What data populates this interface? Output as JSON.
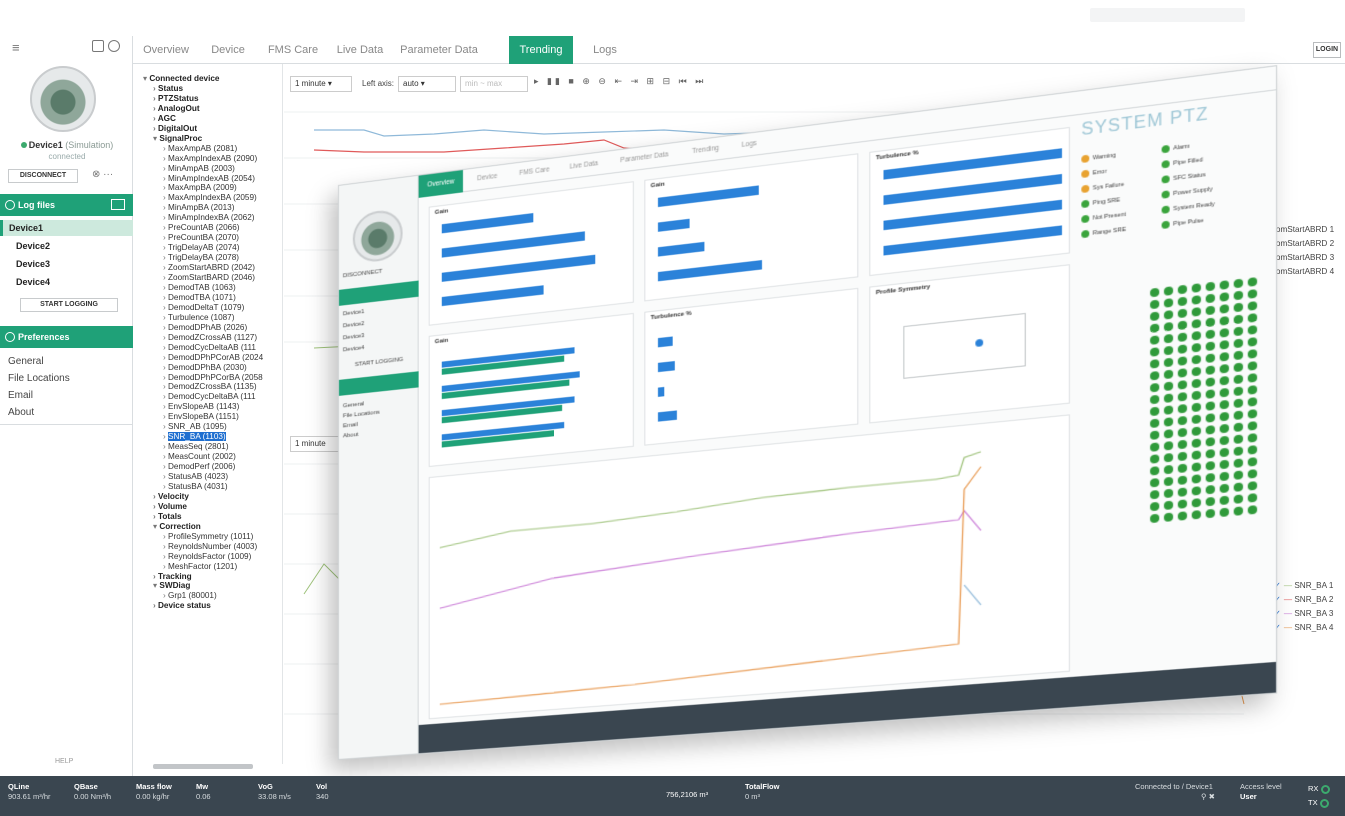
{
  "header": {
    "login_label": "LOGIN"
  },
  "tabs": [
    "Overview",
    "Device",
    "FMS Care",
    "Live Data",
    "Parameter Data",
    "Trending",
    "Logs"
  ],
  "active_tab": "Trending",
  "sidebar": {
    "device_name": "Device1",
    "device_status": "(Simulation)",
    "device_sub": "connected",
    "disconnect_label": "DISCONNECT",
    "log_files_label": "Log files",
    "devices": [
      "Device1",
      "Device2",
      "Device3",
      "Device4"
    ],
    "selected_device": "Device1",
    "start_logging_label": "START LOGGING",
    "preferences_label": "Preferences",
    "preferences_items": [
      "General",
      "File Locations",
      "Email",
      "About"
    ],
    "footer": "HELP"
  },
  "tree": {
    "items": [
      {
        "text": "Connected device",
        "level": 0,
        "bold": true,
        "toggle": "▾"
      },
      {
        "text": "Status",
        "level": 1,
        "bold": true,
        "toggle": "›"
      },
      {
        "text": "PTZStatus",
        "level": 1,
        "bold": true,
        "toggle": "›"
      },
      {
        "text": "AnalogOut",
        "level": 1,
        "bold": true,
        "toggle": "›"
      },
      {
        "text": "AGC",
        "level": 1,
        "bold": true,
        "toggle": "›"
      },
      {
        "text": "DigitalOut",
        "level": 1,
        "bold": true,
        "toggle": "›"
      },
      {
        "text": "SignalProc",
        "level": 1,
        "bold": true,
        "toggle": "▾"
      },
      {
        "text": "MaxAmpAB (2081)",
        "level": 2
      },
      {
        "text": "MaxAmpIndexAB (2090)",
        "level": 2
      },
      {
        "text": "MinAmpAB (2003)",
        "level": 2
      },
      {
        "text": "MinAmpIndexAB (2054)",
        "level": 2
      },
      {
        "text": "MaxAmpBA (2009)",
        "level": 2
      },
      {
        "text": "MaxAmpIndexBA (2059)",
        "level": 2
      },
      {
        "text": "MinAmpBA (2013)",
        "level": 2
      },
      {
        "text": "MinAmpIndexBA (2062)",
        "level": 2
      },
      {
        "text": "PreCountAB (2066)",
        "level": 2
      },
      {
        "text": "PreCountBA (2070)",
        "level": 2
      },
      {
        "text": "TrigDelayAB (2074)",
        "level": 2
      },
      {
        "text": "TrigDelayBA (2078)",
        "level": 2
      },
      {
        "text": "ZoomStartABRD (2042)",
        "level": 2
      },
      {
        "text": "ZoomStartBARD (2046)",
        "level": 2
      },
      {
        "text": "DemodTAB (1063)",
        "level": 2
      },
      {
        "text": "DemodTBA (1071)",
        "level": 2
      },
      {
        "text": "DemodDeltaT (1079)",
        "level": 2
      },
      {
        "text": "Turbulence (1087)",
        "level": 2
      },
      {
        "text": "DemodDPhAB (2026)",
        "level": 2
      },
      {
        "text": "DemodZCrossAB (1127)",
        "level": 2
      },
      {
        "text": "DemodCycDeltaAB (111",
        "level": 2
      },
      {
        "text": "DemodDPhPCorAB (2024",
        "level": 2
      },
      {
        "text": "DemodDPhBA (2030)",
        "level": 2
      },
      {
        "text": "DemodDPhPCorBA (2058",
        "level": 2
      },
      {
        "text": "DemodZCrossBA (1135)",
        "level": 2
      },
      {
        "text": "DemodCycDeltaBA (111",
        "level": 2
      },
      {
        "text": "EnvSlopeAB (1143)",
        "level": 2
      },
      {
        "text": "EnvSlopeBA (1151)",
        "level": 2
      },
      {
        "text": "SNR_AB (1095)",
        "level": 2
      },
      {
        "text": "SNR_BA (1103)",
        "level": 2,
        "highlight": true
      },
      {
        "text": "MeasSeq (2801)",
        "level": 2
      },
      {
        "text": "MeasCount (2002)",
        "level": 2
      },
      {
        "text": "DemodPerf (2006)",
        "level": 2
      },
      {
        "text": "StatusAB (4023)",
        "level": 2
      },
      {
        "text": "StatusBA (4031)",
        "level": 2
      },
      {
        "text": "Velocity",
        "level": 1,
        "bold": true,
        "toggle": "›"
      },
      {
        "text": "Volume",
        "level": 1,
        "bold": true,
        "toggle": "›"
      },
      {
        "text": "Totals",
        "level": 1,
        "bold": true,
        "toggle": "›"
      },
      {
        "text": "Correction",
        "level": 1,
        "bold": true,
        "toggle": "▾"
      },
      {
        "text": "ProfileSymmetry (1011)",
        "level": 2
      },
      {
        "text": "ReynoldsNumber (4003)",
        "level": 2
      },
      {
        "text": "ReynoldsFactor (1009)",
        "level": 2
      },
      {
        "text": "MeshFactor (1201)",
        "level": 2
      },
      {
        "text": "Tracking",
        "level": 1,
        "bold": true,
        "toggle": "›"
      },
      {
        "text": "SWDiag",
        "level": 1,
        "bold": true,
        "toggle": "▾"
      },
      {
        "text": "Grp1 (80001)",
        "level": 2
      },
      {
        "text": "Device status",
        "level": 1,
        "bold": true,
        "toggle": "›"
      }
    ]
  },
  "trend_toolbar": {
    "time_select": "1 minute",
    "left_axis_label": "Left axis:",
    "left_axis_value": "auto",
    "time_select_2": "1 minute"
  },
  "legend_top": [
    "ZoomStartABRD 1",
    "ZoomStartABRD 2",
    "ZoomStartABRD 3",
    "ZoomStartABRD 4"
  ],
  "legend_bottom": [
    "SNR_BA 1",
    "SNR_BA 2",
    "SNR_BA 3",
    "SNR_BA 4"
  ],
  "status_bar": {
    "items": [
      {
        "label": "QLine",
        "value": "903.61 m³/hr"
      },
      {
        "label": "QBase",
        "value": "0.00 Nm³/h"
      },
      {
        "label": "Mass flow",
        "value": "0.00 kg/hr"
      },
      {
        "label": "Mw",
        "value": "0.06"
      },
      {
        "label": "VoG",
        "value": "33.08 m/s"
      },
      {
        "label": "Vol",
        "value": "340"
      }
    ],
    "total_main": {
      "label": "TotalFlow",
      "value": "0 m³"
    },
    "total_fwd": {
      "value": "756,2106 m³"
    },
    "connected_label": "Connected to / Device1",
    "access_label": "Access level",
    "access_value": "User",
    "rx": "RX",
    "tx": "TX"
  },
  "overlay": {
    "system_title": "SYSTEM PTZ",
    "tabs": [
      "Overview",
      "Device",
      "FMS Care",
      "Live Data",
      "Parameter Data",
      "Trending",
      "Logs"
    ],
    "card_titles": [
      "Gain",
      "Gain",
      "Turbulence %",
      "Gain",
      "Turbulence %",
      "Profile Symmetry"
    ],
    "status_lights": [
      "Warning",
      "Error",
      "Sys Failure",
      "Ping SRE",
      "Not Present",
      "Range SRE",
      "Alarm",
      "Pipe Filled",
      "SFC Status",
      "Power Supply",
      "System Ready",
      "Pipe Pulse"
    ],
    "side_items": [
      "Device1",
      "Device2",
      "Device3",
      "Device4"
    ],
    "pref_items": [
      "General",
      "File Locations",
      "Email",
      "About"
    ],
    "disconnect": "DISCONNECT",
    "start_logging": "START LOGGING"
  },
  "colors": {
    "accent": "#1fa178",
    "statusbar": "#3a4650",
    "series_blue": "#8fb9d9",
    "series_red": "#e05a5a",
    "series_green": "#9ec27a",
    "series_purple": "#c97ad6",
    "series_orange": "#e89a52"
  }
}
